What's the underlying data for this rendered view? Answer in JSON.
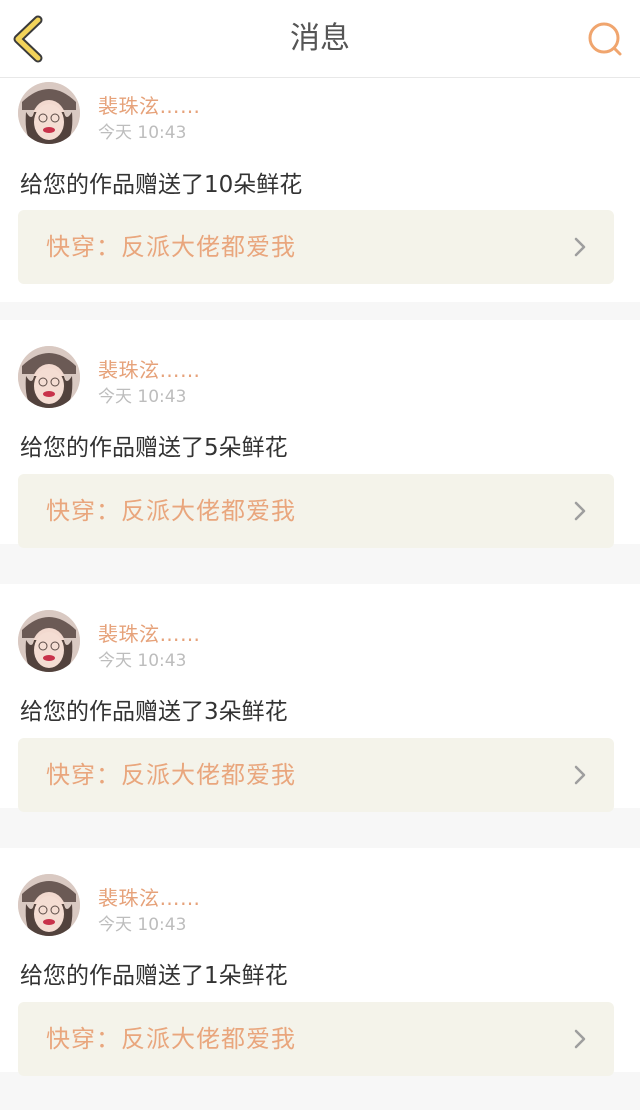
{
  "header": {
    "title": "消息",
    "back_icon": "chevron-left-icon",
    "search_icon": "search-icon",
    "back_color": "#f2d35a",
    "search_color": "#f0a56e"
  },
  "messages": [
    {
      "username": "裴珠泫……",
      "time": "今天 10:43",
      "text": "给您的作品赠送了10朵鲜花",
      "work_title": "快穿：反派大佬都爱我"
    },
    {
      "username": "裴珠泫……",
      "time": "今天 10:43",
      "text": "给您的作品赠送了5朵鲜花",
      "work_title": "快穿：反派大佬都爱我"
    },
    {
      "username": "裴珠泫……",
      "time": "今天 10:43",
      "text": "给您的作品赠送了3朵鲜花",
      "work_title": "快穿：反派大佬都爱我"
    },
    {
      "username": "裴珠泫……",
      "time": "今天 10:43",
      "text": "给您的作品赠送了1朵鲜花",
      "work_title": "快穿：反派大佬都爱我"
    }
  ]
}
